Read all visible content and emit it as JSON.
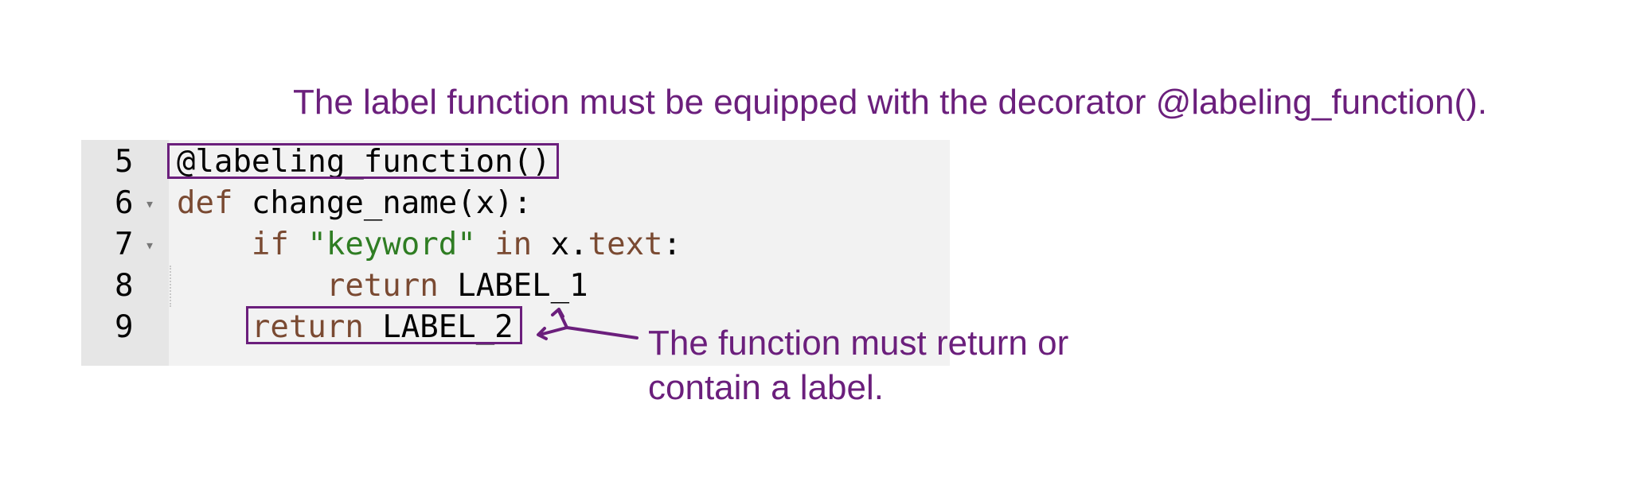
{
  "annotations": {
    "decorator_note": "The label function must be equipped with the decorator @labeling_function().",
    "return_note_line1": "The function must return or",
    "return_note_line2": "contain a label."
  },
  "editor": {
    "lines": [
      {
        "number": "5",
        "foldable": false,
        "tokens": [
          {
            "t": "@labeling_function()",
            "c": "plain"
          }
        ]
      },
      {
        "number": "6",
        "foldable": true,
        "tokens": [
          {
            "t": "def",
            "c": "kw"
          },
          {
            "t": " change_name(x):",
            "c": "plain"
          }
        ]
      },
      {
        "number": "7",
        "foldable": true,
        "tokens": [
          {
            "t": "    if",
            "c": "kw"
          },
          {
            "t": " ",
            "c": "plain"
          },
          {
            "t": "\"keyword\"",
            "c": "str"
          },
          {
            "t": " ",
            "c": "plain"
          },
          {
            "t": "in",
            "c": "kw"
          },
          {
            "t": " x.",
            "c": "plain"
          },
          {
            "t": "text",
            "c": "attr"
          },
          {
            "t": ":",
            "c": "plain"
          }
        ]
      },
      {
        "number": "8",
        "foldable": false,
        "tokens": [
          {
            "t": "        return",
            "c": "kw"
          },
          {
            "t": " LABEL_1",
            "c": "plain"
          }
        ]
      },
      {
        "number": "9",
        "foldable": false,
        "tokens": [
          {
            "t": "    return",
            "c": "kw"
          },
          {
            "t": " LABEL_2",
            "c": "plain"
          }
        ]
      }
    ],
    "fold_icon": "triangle-down-icon"
  },
  "colors": {
    "annotation": "#6b1f7c",
    "keyword": "#7a4a32",
    "string": "#2f7d23",
    "editor_bg": "#f2f2f2",
    "gutter_bg": "#e6e6e6"
  }
}
